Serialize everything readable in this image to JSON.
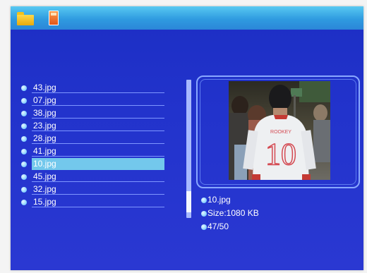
{
  "toolbar": {
    "icons": [
      "folder-icon",
      "memory-card-icon"
    ]
  },
  "file_list": {
    "items": [
      {
        "name": "43.jpg",
        "selected": false
      },
      {
        "name": "07.jpg",
        "selected": false
      },
      {
        "name": "38.jpg",
        "selected": false
      },
      {
        "name": "23.jpg",
        "selected": false
      },
      {
        "name": "28.jpg",
        "selected": false
      },
      {
        "name": "41.jpg",
        "selected": false
      },
      {
        "name": "10.jpg",
        "selected": true
      },
      {
        "name": "45.jpg",
        "selected": false
      },
      {
        "name": "32.jpg",
        "selected": false
      },
      {
        "name": "15.jpg",
        "selected": false
      }
    ]
  },
  "preview": {
    "shirt_text": "ROOKEY",
    "shirt_number": "10"
  },
  "info": {
    "filename": "10.jpg",
    "size": "Size:1080 KB",
    "position": "47/50"
  },
  "colors": {
    "background": "#2233cc",
    "topbar": "#2f9be0",
    "selected_row": "#73c8ec",
    "text": "#ffffff"
  }
}
